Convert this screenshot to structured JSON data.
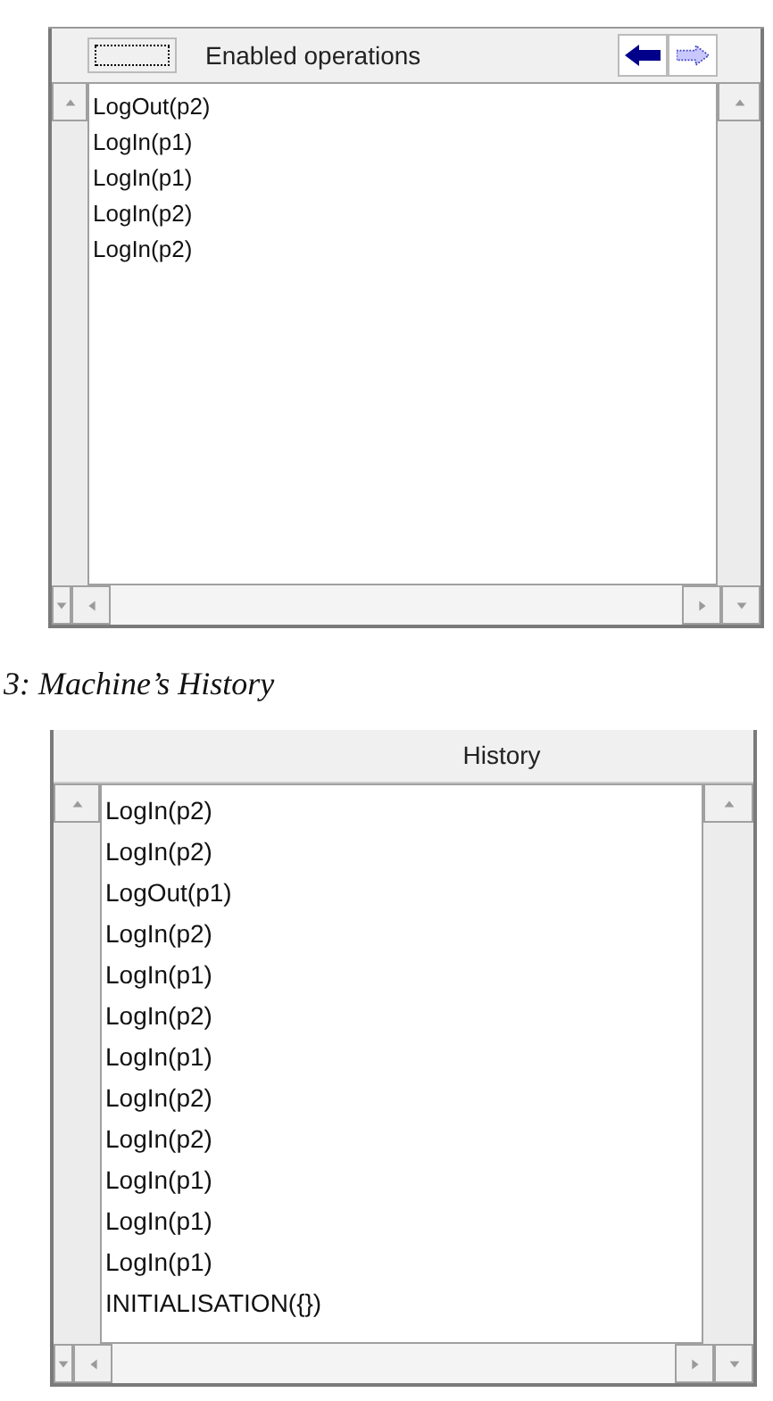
{
  "enabled_panel": {
    "title": "Enabled operations",
    "operations": [
      "LogOut(p2)",
      "LogIn(p1)",
      "LogIn(p1)",
      "LogIn(p2)",
      "LogIn(p2)"
    ]
  },
  "caption": "3: Machine’s History",
  "history_panel": {
    "title": "History",
    "entries": [
      "LogIn(p2)",
      "LogIn(p2)",
      "LogOut(p1)",
      "LogIn(p2)",
      "LogIn(p1)",
      "LogIn(p2)",
      "LogIn(p1)",
      "LogIn(p2)",
      "LogIn(p2)",
      "LogIn(p1)",
      "LogIn(p1)",
      "LogIn(p1)",
      "INITIALISATION({})"
    ]
  }
}
